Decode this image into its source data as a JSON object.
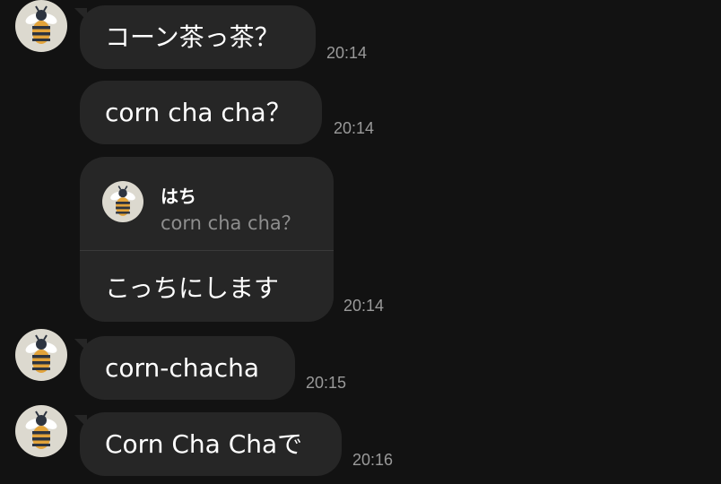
{
  "messages": [
    {
      "text": "コーン茶っ茶？",
      "time": "20:14"
    },
    {
      "text": "corn cha cha？",
      "time": "20:14"
    },
    {
      "reply": {
        "name": "はち",
        "quote": "corn cha cha？"
      },
      "text": "こっちにします",
      "time": "20:14"
    },
    {
      "text": "corn-chacha",
      "time": "20:15"
    },
    {
      "text": "Corn Cha Chaで",
      "time": "20:16"
    }
  ],
  "avatar_icon": "bee-icon",
  "colors": {
    "background": "#121212",
    "bubble": "#262626",
    "timestamp": "#9a9a9a",
    "quote_text": "#8e8e8e",
    "avatar_bg": "#dcd9cf"
  }
}
